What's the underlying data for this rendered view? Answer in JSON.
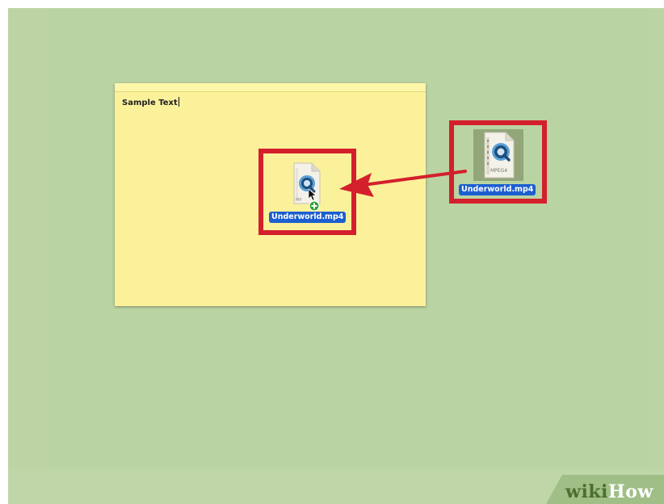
{
  "note": {
    "text": "Sample Text"
  },
  "files": {
    "dragged": {
      "name": "Underworld.mp4",
      "icon": "quicktime-movie-file-icon",
      "badge_icon": "add-copy-badge-icon"
    },
    "source": {
      "name": "Underworld.mp4",
      "icon": "quicktime-mpeg4-file-icon",
      "type_label": "MPEG4"
    }
  },
  "watermark": {
    "part1": "wiki",
    "part2": "How"
  },
  "colors": {
    "desktop": "#bcd4a4",
    "note": "#fbf19b",
    "highlight": "#d3202c",
    "selection": "#1c5fd0"
  }
}
